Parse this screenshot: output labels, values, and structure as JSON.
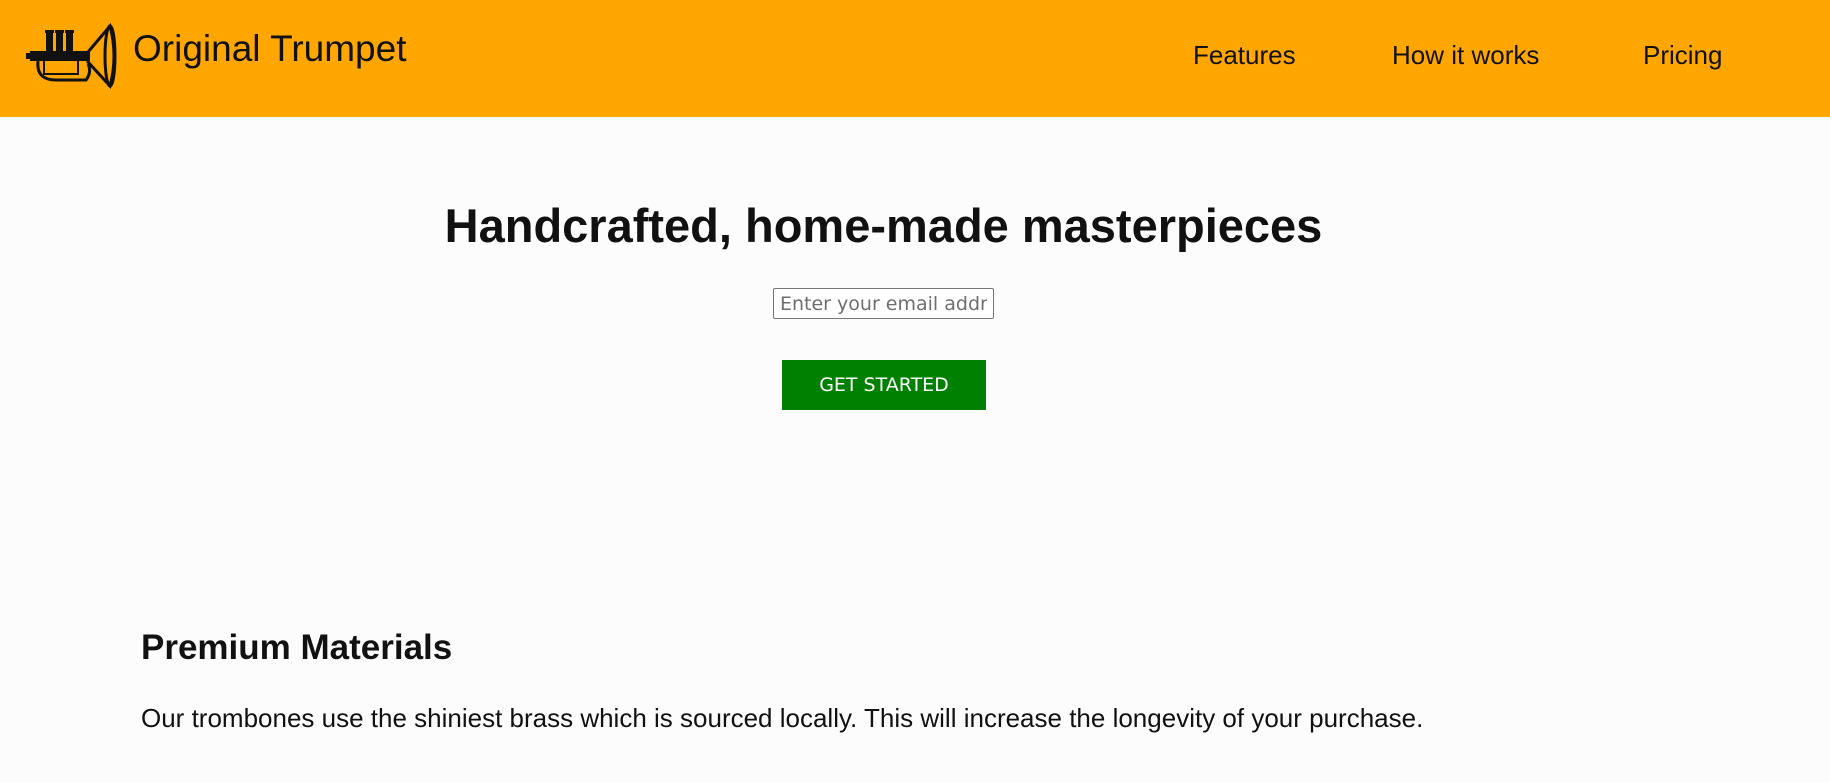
{
  "header": {
    "logo_icon": "trumpet-icon",
    "brand_name": "Original Trumpet",
    "nav": {
      "features": "Features",
      "how_it_works": "How it works",
      "pricing": "Pricing"
    }
  },
  "hero": {
    "title": "Handcrafted, home-made masterpieces",
    "email": {
      "value": "",
      "placeholder": "Enter your email address"
    },
    "cta_label": "GET STARTED"
  },
  "features": {
    "title": "Premium Materials",
    "body": "Our trombones use the shiniest brass which is sourced locally. This will increase the longevity of your purchase."
  },
  "colors": {
    "header_bg": "#ffa600",
    "cta_bg": "#008000",
    "page_bg": "#fcfcfd"
  }
}
